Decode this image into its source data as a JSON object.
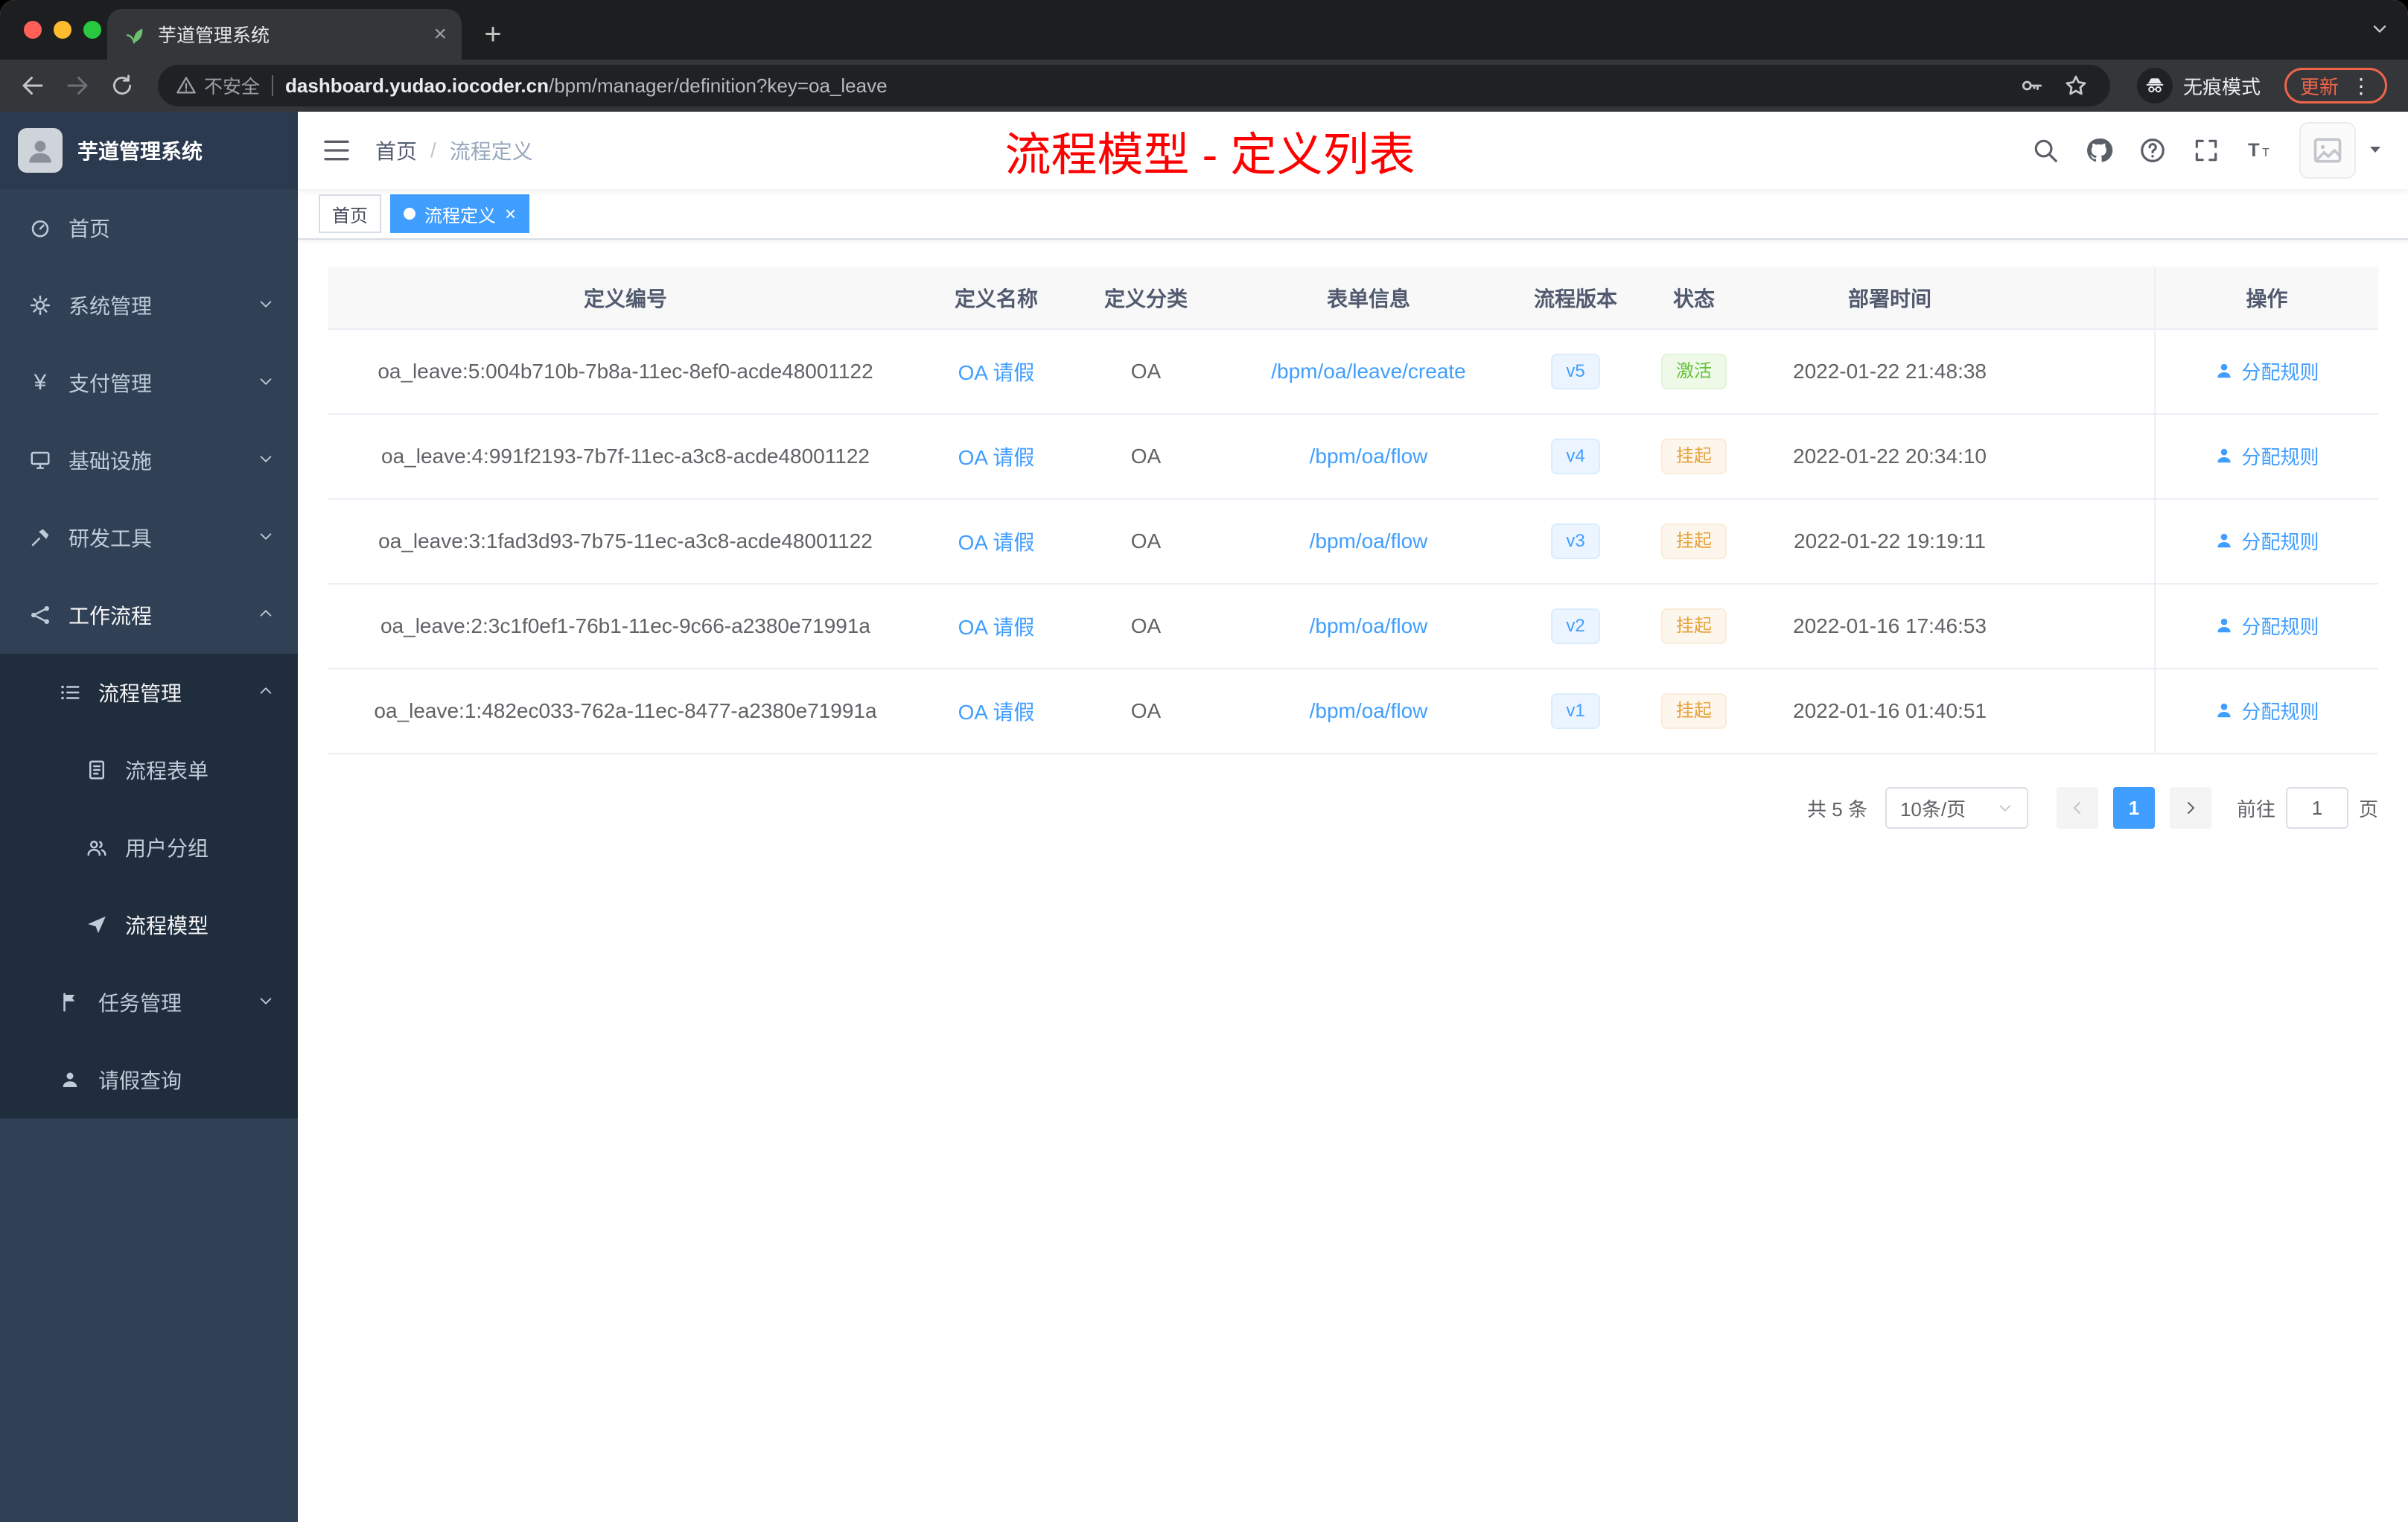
{
  "browser": {
    "tab_title": "芋道管理系统",
    "security_label": "不安全",
    "url_domain": "dashboard.yudao.iocoder.cn",
    "url_path": "/bpm/manager/definition?key=oa_leave",
    "incognito_label": "无痕模式",
    "update_label": "更新"
  },
  "sidebar": {
    "logo_title": "芋道管理系统",
    "items": [
      {
        "label": "首页"
      },
      {
        "label": "系统管理"
      },
      {
        "label": "支付管理"
      },
      {
        "label": "基础设施"
      },
      {
        "label": "研发工具"
      },
      {
        "label": "工作流程"
      },
      {
        "label": "流程管理"
      },
      {
        "label": "流程表单"
      },
      {
        "label": "用户分组"
      },
      {
        "label": "流程模型"
      },
      {
        "label": "任务管理"
      },
      {
        "label": "请假查询"
      }
    ]
  },
  "header": {
    "breadcrumb_home": "首页",
    "breadcrumb_current": "流程定义",
    "annotation": "流程模型 - 定义列表"
  },
  "tags": {
    "home": "首页",
    "active": "流程定义"
  },
  "table": {
    "columns": [
      "定义编号",
      "定义名称",
      "定义分类",
      "表单信息",
      "流程版本",
      "状态",
      "部署时间",
      "操作"
    ],
    "rows": [
      {
        "id": "oa_leave:5:004b710b-7b8a-11ec-8ef0-acde48001122",
        "name": "OA 请假",
        "category": "OA",
        "form": "/bpm/oa/leave/create",
        "version": "v5",
        "status": "激活",
        "time": "2022-01-22 21:48:38",
        "action": "分配规则"
      },
      {
        "id": "oa_leave:4:991f2193-7b7f-11ec-a3c8-acde48001122",
        "name": "OA 请假",
        "category": "OA",
        "form": "/bpm/oa/flow",
        "version": "v4",
        "status": "挂起",
        "time": "2022-01-22 20:34:10",
        "action": "分配规则"
      },
      {
        "id": "oa_leave:3:1fad3d93-7b75-11ec-a3c8-acde48001122",
        "name": "OA 请假",
        "category": "OA",
        "form": "/bpm/oa/flow",
        "version": "v3",
        "status": "挂起",
        "time": "2022-01-22 19:19:11",
        "action": "分配规则"
      },
      {
        "id": "oa_leave:2:3c1f0ef1-76b1-11ec-9c66-a2380e71991a",
        "name": "OA 请假",
        "category": "OA",
        "form": "/bpm/oa/flow",
        "version": "v2",
        "status": "挂起",
        "time": "2022-01-16 17:46:53",
        "action": "分配规则"
      },
      {
        "id": "oa_leave:1:482ec033-762a-11ec-8477-a2380e71991a",
        "name": "OA 请假",
        "category": "OA",
        "form": "/bpm/oa/flow",
        "version": "v1",
        "status": "挂起",
        "time": "2022-01-16 01:40:51",
        "action": "分配规则"
      }
    ]
  },
  "pagination": {
    "total": "共 5 条",
    "page_size": "10条/页",
    "page": "1",
    "goto_label": "前往",
    "goto_value": "1",
    "page_unit": "页"
  },
  "colors": {
    "accent": "#409eff",
    "success": "#67c23a",
    "warning": "#e6a23c",
    "annotation": "#fe0000",
    "sidebar_bg": "#304156",
    "sidebar_sub_bg": "#1f2d3d"
  }
}
